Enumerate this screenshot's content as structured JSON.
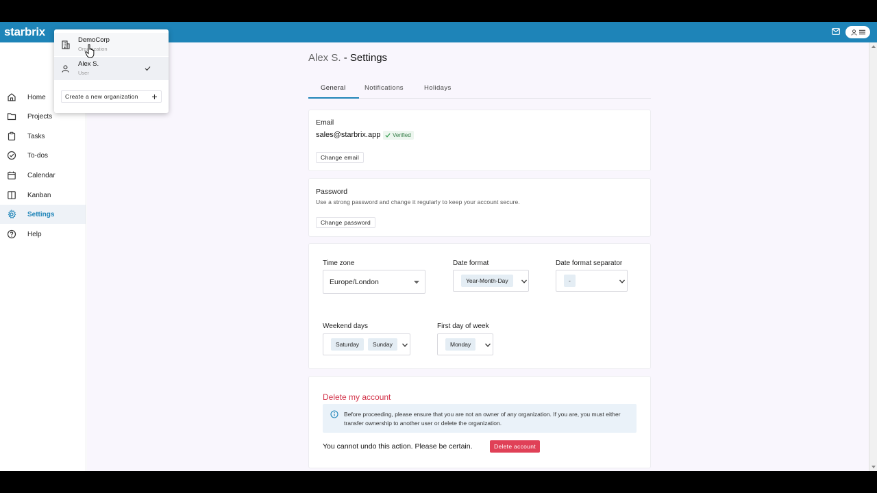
{
  "app": {
    "brand": "starbrix"
  },
  "topbar": {
    "mail_icon": "mail-icon",
    "user_menu_icons": [
      "user-icon",
      "menu-icon"
    ]
  },
  "sidebar": {
    "items": [
      {
        "label": "Home",
        "icon": "home-icon"
      },
      {
        "label": "Projects",
        "icon": "folder-icon"
      },
      {
        "label": "Tasks",
        "icon": "clipboard-icon"
      },
      {
        "label": "To-dos",
        "icon": "check-circle-icon"
      },
      {
        "label": "Calendar",
        "icon": "calendar-icon"
      },
      {
        "label": "Kanban",
        "icon": "kanban-icon"
      },
      {
        "label": "Settings",
        "icon": "gear-icon",
        "active": true
      },
      {
        "label": "Help",
        "icon": "help-icon"
      }
    ]
  },
  "dropdown": {
    "items": [
      {
        "title": "DemoCorp",
        "subtitle": "Organization",
        "icon": "building-icon"
      },
      {
        "title": "Alex S.",
        "subtitle": "User",
        "icon": "user-icon",
        "checked": true
      }
    ],
    "create_label": "Create a new organization"
  },
  "page": {
    "title_user": "Alex S.",
    "title_rest": " - Settings"
  },
  "tabs": [
    {
      "label": "General",
      "active": true
    },
    {
      "label": "Notifications"
    },
    {
      "label": "Holidays"
    }
  ],
  "email": {
    "title": "Email",
    "value": "sales@starbrix.app",
    "verified_label": "Verified",
    "change_label": "Change email"
  },
  "password": {
    "title": "Password",
    "description": "Use a strong password and change it regularly to keep your account secure.",
    "change_label": "Change password"
  },
  "preferences": {
    "timezone_label": "Time zone",
    "timezone_value": "Europe/London",
    "date_format_label": "Date format",
    "date_format_value": "Year-Month-Day",
    "separator_label": "Date format separator",
    "separator_value": "-",
    "weekend_label": "Weekend days",
    "weekend_values": [
      "Saturday",
      "Sunday"
    ],
    "first_day_label": "First day of week",
    "first_day_value": "Monday"
  },
  "delete": {
    "title": "Delete my account",
    "notice": "Before proceeding, please ensure that you are not an owner of any organization. If you are, you must either transfer ownership to another user or delete the organization.",
    "warning": "You cannot undo this action. Please be certain.",
    "button_label": "Delete account"
  },
  "colors": {
    "brand": "#1e84b8",
    "danger": "#e04057",
    "verified": "#2e9a4a"
  }
}
